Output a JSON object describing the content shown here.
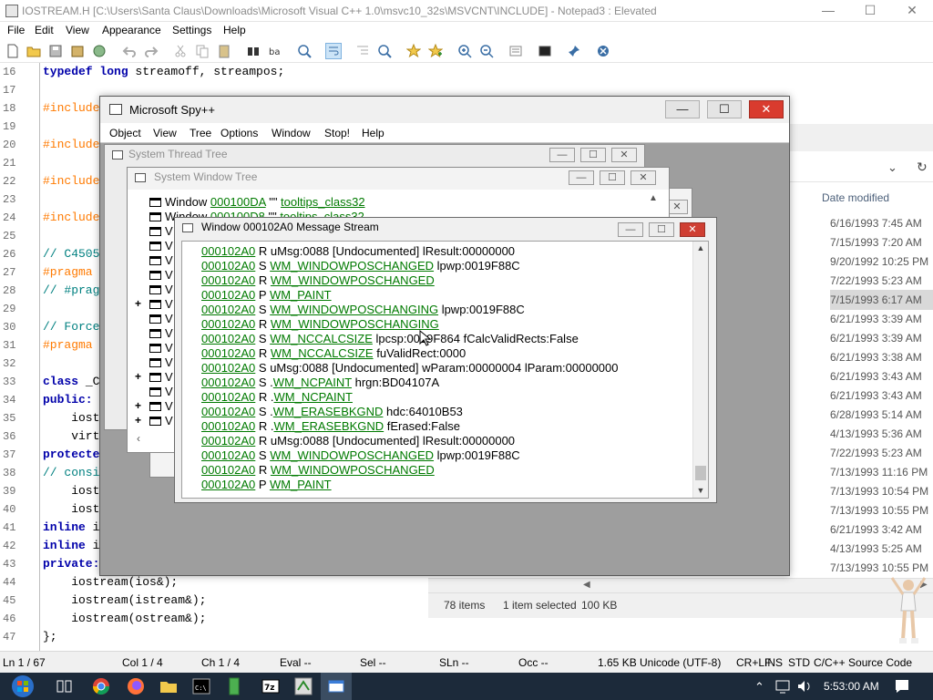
{
  "notepad": {
    "title": "IOSTREAM.H [C:\\Users\\Santa Claus\\Downloads\\Microsoft Visual C++ 1.0\\msvc10_32s\\MSVCNT\\INCLUDE] - Notepad3 : Elevated",
    "menu": [
      "File",
      "Edit",
      "View",
      "Appearance",
      "Settings",
      "Help"
    ],
    "window_buttons": {
      "minimize": "—",
      "maximize": "☐",
      "close": "✕"
    },
    "lines": [
      {
        "n": "16",
        "parts": [
          [
            "kw",
            "typedef long "
          ],
          [
            "fn",
            "streamoff, streampos;"
          ]
        ]
      },
      {
        "n": "17",
        "parts": []
      },
      {
        "n": "18",
        "parts": [
          [
            "pp",
            "#include"
          ]
        ]
      },
      {
        "n": "19",
        "parts": []
      },
      {
        "n": "20",
        "parts": [
          [
            "pp",
            "#include"
          ]
        ]
      },
      {
        "n": "21",
        "parts": []
      },
      {
        "n": "22",
        "parts": [
          [
            "pp",
            "#include"
          ]
        ]
      },
      {
        "n": "23",
        "parts": []
      },
      {
        "n": "24",
        "parts": [
          [
            "pp",
            "#include"
          ]
        ]
      },
      {
        "n": "25",
        "parts": []
      },
      {
        "n": "26",
        "parts": [
          [
            "cm",
            "// C4505"
          ]
        ]
      },
      {
        "n": "27",
        "parts": [
          [
            "pp",
            "#pragma"
          ]
        ]
      },
      {
        "n": "28",
        "parts": [
          [
            "cm",
            "// #prag"
          ]
        ]
      },
      {
        "n": "29",
        "parts": []
      },
      {
        "n": "30",
        "parts": [
          [
            "cm",
            "// Force"
          ]
        ]
      },
      {
        "n": "31",
        "parts": [
          [
            "pp",
            "#pragma"
          ]
        ]
      },
      {
        "n": "32",
        "parts": []
      },
      {
        "n": "33",
        "parts": [
          [
            "kw",
            "class "
          ],
          [
            "fn",
            "_C"
          ]
        ]
      },
      {
        "n": "34",
        "parts": [
          [
            "kw",
            "public:"
          ]
        ]
      },
      {
        "n": "35",
        "parts": [
          [
            "fn",
            "    iost"
          ]
        ]
      },
      {
        "n": "36",
        "parts": [
          [
            "fn",
            "    virt"
          ]
        ]
      },
      {
        "n": "37",
        "parts": [
          [
            "kw",
            "protecte"
          ]
        ]
      },
      {
        "n": "38",
        "parts": [
          [
            "cm",
            "// consi"
          ]
        ]
      },
      {
        "n": "39",
        "parts": [
          [
            "fn",
            "    iost"
          ]
        ]
      },
      {
        "n": "40",
        "parts": [
          [
            "fn",
            "    iost"
          ]
        ]
      },
      {
        "n": "41",
        "parts": [
          [
            "kw",
            "inline "
          ],
          [
            "fn",
            "i"
          ]
        ]
      },
      {
        "n": "42",
        "parts": [
          [
            "kw",
            "inline "
          ],
          [
            "fn",
            "i"
          ]
        ]
      },
      {
        "n": "43",
        "parts": [
          [
            "kw",
            "private:"
          ]
        ]
      },
      {
        "n": "44",
        "parts": [
          [
            "fn",
            "    iostream(ios&);"
          ]
        ]
      },
      {
        "n": "45",
        "parts": [
          [
            "fn",
            "    iostream(istream&);"
          ]
        ]
      },
      {
        "n": "46",
        "parts": [
          [
            "fn",
            "    iostream(ostream&);"
          ]
        ]
      },
      {
        "n": "47",
        "parts": [
          [
            "fn",
            "};"
          ]
        ]
      }
    ],
    "status": {
      "ln": "Ln  1 / 67",
      "col": "Col  1 / 4",
      "ch": "Ch  1 / 4",
      "eval": "Eval  --",
      "sel": "Sel  --",
      "sln": "SLn  --",
      "occ": "Occ  --",
      "size": "1.65 KB",
      "encoding": "Unicode (UTF-8)",
      "eol": "CR+LF",
      "ins": "INS",
      "std": "STD",
      "lexer": "C/C++ Source Code"
    }
  },
  "explorer": {
    "column_header": "Date modified",
    "dates": [
      "6/16/1993 7:45 AM",
      "7/15/1993 7:20 AM",
      "9/20/1992 10:25 PM",
      "7/22/1993 5:23 AM",
      "7/15/1993 6:17 AM",
      "6/21/1993 3:39 AM",
      "6/21/1993 3:39 AM",
      "6/21/1993 3:38 AM",
      "6/21/1993 3:43 AM",
      "6/21/1993 3:43 AM",
      "6/28/1993 5:14 AM",
      "4/13/1993 5:36 AM",
      "7/22/1993 5:23 AM",
      "7/13/1993 11:16 PM",
      "7/13/1993 10:54 PM",
      "7/13/1993 10:55 PM",
      "6/21/1993 3:42 AM",
      "4/13/1993 5:25 AM",
      "7/13/1993 10:55 PM"
    ],
    "selected_index": 4,
    "item_count": "78 items",
    "selection": "1 item selected",
    "selection_size": "100 KB"
  },
  "spy": {
    "title": "Microsoft Spy++",
    "menu": [
      "Object",
      "View",
      "Tree",
      "Options",
      "Window",
      "Stop!",
      "Help"
    ],
    "thread_tree_title": "System Thread Tree",
    "window_tree_title": "System Window Tree",
    "window_tree_rows": [
      {
        "prefix": "Window ",
        "handle": "000100DA",
        "mid": " \"\" ",
        "cls": "tooltips_class32"
      },
      {
        "prefix": "Window ",
        "handle": "000100D8",
        "mid": " \"\" ",
        "cls": "tooltips_class32"
      }
    ],
    "tree_row_prefix": "V",
    "message_window_title": "Window 000102A0 Message Stream",
    "messages": [
      {
        "h": "000102A0",
        "t": " R ",
        "m": "",
        "r": "uMsg:0088 [Undocumented] lResult:00000000"
      },
      {
        "h": "000102A0",
        "t": " S ",
        "m": "WM_WINDOWPOSCHANGED",
        "r": " lpwp:0019F88C"
      },
      {
        "h": "000102A0",
        "t": " R ",
        "m": "WM_WINDOWPOSCHANGED",
        "r": ""
      },
      {
        "h": "000102A0",
        "t": " P ",
        "m": "WM_PAINT",
        "r": ""
      },
      {
        "h": "000102A0",
        "t": " S ",
        "m": "WM_WINDOWPOSCHANGING",
        "r": " lpwp:0019F88C"
      },
      {
        "h": "000102A0",
        "t": " R ",
        "m": "WM_WINDOWPOSCHANGING",
        "r": ""
      },
      {
        "h": "000102A0",
        "t": " S ",
        "m": "WM_NCCALCSIZE",
        "r": " lpcsp:0019F864 fCalcValidRects:False"
      },
      {
        "h": "000102A0",
        "t": " R ",
        "m": "WM_NCCALCSIZE",
        "r": " fuValidRect:0000"
      },
      {
        "h": "000102A0",
        "t": " S ",
        "m": "",
        "r": "uMsg:0088 [Undocumented] wParam:00000004 lParam:00000000"
      },
      {
        "h": "000102A0",
        "t": " S .",
        "m": "WM_NCPAINT",
        "r": " hrgn:BD04107A"
      },
      {
        "h": "000102A0",
        "t": " R .",
        "m": "WM_NCPAINT",
        "r": ""
      },
      {
        "h": "000102A0",
        "t": " S .",
        "m": "WM_ERASEBKGND",
        "r": " hdc:64010B53"
      },
      {
        "h": "000102A0",
        "t": " R .",
        "m": "WM_ERASEBKGND",
        "r": " fErased:False"
      },
      {
        "h": "000102A0",
        "t": " R ",
        "m": "",
        "r": "uMsg:0088 [Undocumented] lResult:00000000"
      },
      {
        "h": "000102A0",
        "t": " S ",
        "m": "WM_WINDOWPOSCHANGED",
        "r": " lpwp:0019F88C"
      },
      {
        "h": "000102A0",
        "t": " R ",
        "m": "WM_WINDOWPOSCHANGED",
        "r": ""
      },
      {
        "h": "000102A0",
        "t": " P ",
        "m": "WM_PAINT",
        "r": ""
      }
    ]
  },
  "taskbar": {
    "clock": "5:53:00 AM",
    "apps": [
      "start",
      "task-view",
      "chrome",
      "firefox",
      "file-explorer",
      "cmd",
      "notepad3",
      "7zip",
      "visual-cpp",
      "spy-plus-plus"
    ]
  },
  "colors": {
    "link_green": "#007a00",
    "accent_red": "#d93b2e",
    "taskbar": "#1c2a3a"
  }
}
